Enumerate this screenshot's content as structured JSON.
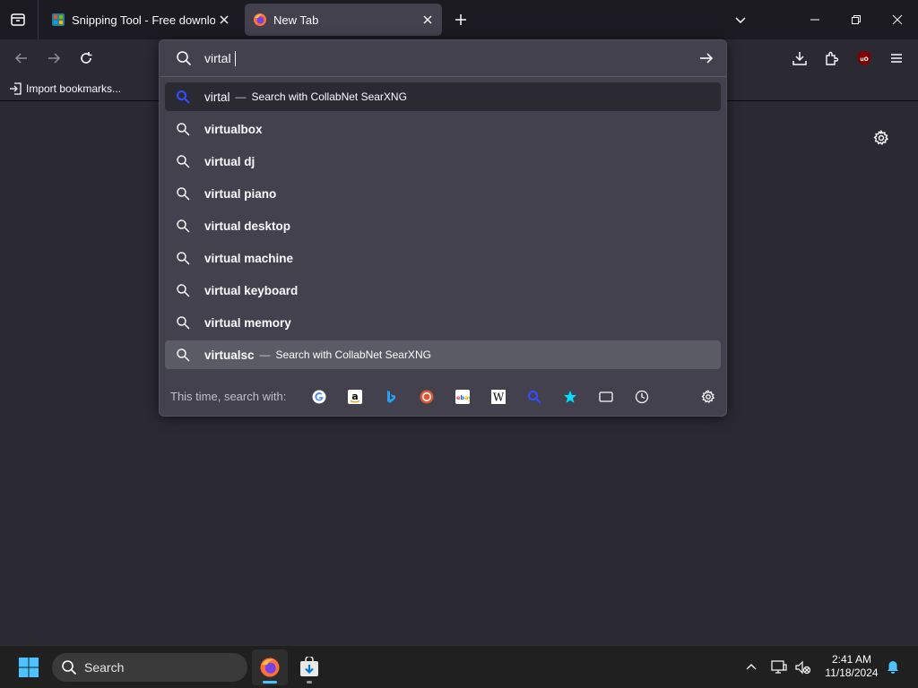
{
  "tabs": [
    {
      "title": "Snipping Tool - Free download",
      "icon": "snipping-tool-favicon",
      "active": false
    },
    {
      "title": "New Tab",
      "icon": "firefox-favicon",
      "active": true
    }
  ],
  "toolbar": {
    "bookmark_import": "Import bookmarks..."
  },
  "urlbar": {
    "value": "virtal",
    "results": [
      {
        "text": "virtal",
        "action": "Search with CollabNet SearXNG",
        "icon": "searxng-search-icon",
        "bold": false
      },
      {
        "text": "virtualbox",
        "icon": "search-icon"
      },
      {
        "text": "virtual dj",
        "icon": "search-icon"
      },
      {
        "text": "virtual piano",
        "icon": "search-icon"
      },
      {
        "text": "virtual desktop",
        "icon": "search-icon"
      },
      {
        "text": "virtual machine",
        "icon": "search-icon"
      },
      {
        "text": "virtual keyboard",
        "icon": "search-icon"
      },
      {
        "text": "virtual memory",
        "icon": "search-icon"
      },
      {
        "text": "virtualsc",
        "action": "Search with CollabNet SearXNG",
        "icon": "search-icon",
        "bold": true
      }
    ],
    "oneoff_label": "This time, search with:",
    "engines": [
      "google",
      "amazon",
      "bing",
      "duckduckgo",
      "ebay",
      "wikipedia",
      "searxng",
      "bookmarks",
      "tabs",
      "history"
    ]
  },
  "taskbar": {
    "search_placeholder": "Search",
    "time": "2:41 AM",
    "date": "11/18/2024"
  },
  "colors": {
    "accent": "#4cc2ff",
    "tab_active": "#42414d",
    "toolbar": "#2b2a33",
    "popup": "#42414d",
    "highlight_row": "#5b5b66"
  }
}
